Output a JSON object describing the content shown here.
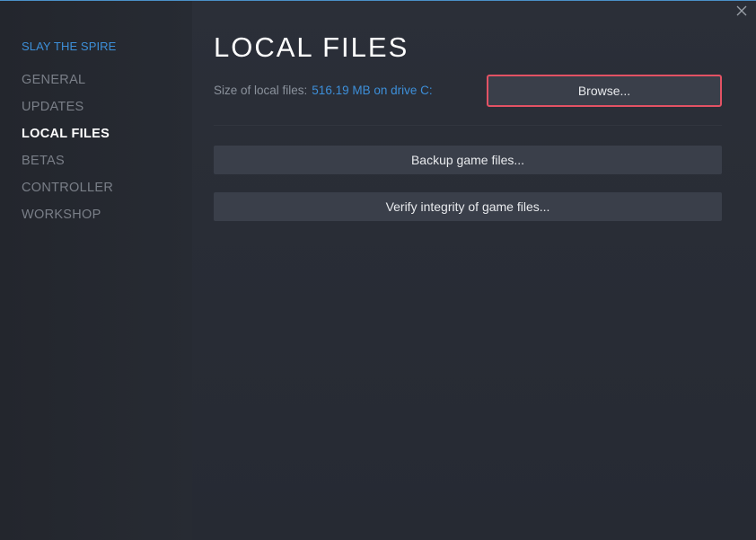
{
  "sidebar": {
    "game_title": "SLAY THE SPIRE",
    "items": [
      {
        "label": "GENERAL",
        "active": false
      },
      {
        "label": "UPDATES",
        "active": false
      },
      {
        "label": "LOCAL FILES",
        "active": true
      },
      {
        "label": "BETAS",
        "active": false
      },
      {
        "label": "CONTROLLER",
        "active": false
      },
      {
        "label": "WORKSHOP",
        "active": false
      }
    ]
  },
  "main": {
    "title": "LOCAL FILES",
    "size_label": "Size of local files:",
    "size_value": "516.19 MB on drive C:",
    "browse_label": "Browse...",
    "backup_label": "Backup game files...",
    "verify_label": "Verify integrity of game files..."
  },
  "window": {
    "close_icon": "close-icon"
  },
  "colors": {
    "accent": "#3d8fd9",
    "highlight_border": "#e35264",
    "background": "#262a33",
    "button": "#3a3f4a"
  }
}
